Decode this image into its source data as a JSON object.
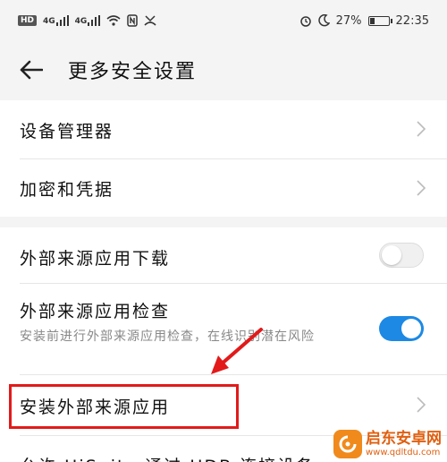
{
  "status_bar": {
    "network_badge": "HD",
    "sim1": "4G",
    "sim2": "4G",
    "battery_percent": "27%",
    "battery_level": 0.27,
    "time": "22:35",
    "icons": [
      "hd-icon",
      "signal-icon",
      "signal-icon",
      "wifi-icon",
      "nfc-icon",
      "missed-call-icon",
      "alarm-icon",
      "moon-icon",
      "battery-icon"
    ]
  },
  "header": {
    "title": "更多安全设置",
    "back_icon": "arrow-left-icon"
  },
  "settings": {
    "device_manager": "设备管理器",
    "encryption": "加密和凭据",
    "external_download": "外部来源应用下载",
    "external_download_enabled": false,
    "external_check": "外部来源应用检查",
    "external_check_desc": "安装前进行外部来源应用检查，在线识别潜在风险",
    "external_check_enabled": true,
    "install_external": "安装外部来源应用",
    "partial_bottom": "允许 HiSuite 通过 HDB 连接设备"
  },
  "annotation": {
    "highlight_color": "#e21a1a"
  },
  "watermark": {
    "title": "启东安卓网",
    "url": "www.qdltdu.com"
  },
  "colors": {
    "accent": "#1d89e4",
    "background": "#f4f4f4"
  }
}
